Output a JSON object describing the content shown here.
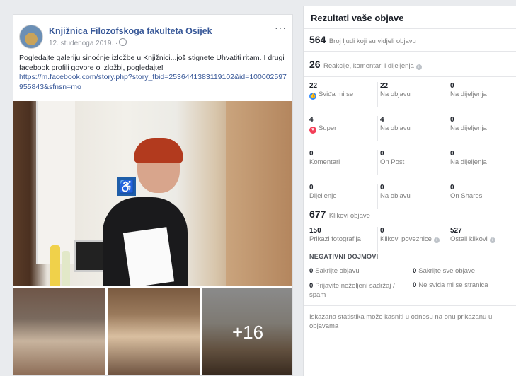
{
  "post": {
    "page_name": "Knjižnica Filozofskoga fakulteta Osijek",
    "date": "12. studenoga 2019. ·",
    "menu": "···",
    "text": "Pogledajte galeriju sinoćnje izložbe u Knjižnici...još stignete Uhvatiti ritam. I drugi facebook profili govore o izložbi, pogledajte!",
    "link": "https://m.facebook.com/story.php?story_fbid=2536441383119102&id=100002597955843&sfnsn=mo",
    "more_photos": "+16",
    "accessibility_sign": "♿"
  },
  "panel": {
    "title": "Rezultati vaše objave",
    "reach": {
      "value": "564",
      "label": "Broj ljudi koji su vidjeli objavu"
    },
    "engagement": {
      "value": "26",
      "label": "Reakcije, komentari i dijeljenja"
    },
    "grid": [
      [
        {
          "n": "22",
          "l": "Sviđa mi se",
          "icon": "like"
        },
        {
          "n": "22",
          "l": "Na objavu"
        },
        {
          "n": "0",
          "l": "Na dijeljenja"
        }
      ],
      [
        {
          "n": "4",
          "l": "Super",
          "icon": "love"
        },
        {
          "n": "4",
          "l": "Na objavu"
        },
        {
          "n": "0",
          "l": "Na dijeljenja"
        }
      ],
      [
        {
          "n": "0",
          "l": "Komentari"
        },
        {
          "n": "0",
          "l": "On Post"
        },
        {
          "n": "0",
          "l": "Na dijeljenja"
        }
      ],
      [
        {
          "n": "0",
          "l": "Dijeljenje"
        },
        {
          "n": "0",
          "l": "Na objavu"
        },
        {
          "n": "0",
          "l": "On Shares"
        }
      ]
    ],
    "clicks": {
      "value": "677",
      "label": "Klikovi objave"
    },
    "click_stats": [
      {
        "n": "150",
        "l": "Prikazi fotografija"
      },
      {
        "n": "0",
        "l": "Klikovi poveznice"
      },
      {
        "n": "527",
        "l": "Ostali klikovi"
      }
    ],
    "negative_title": "NEGATIVNI DOJMOVI",
    "negative": [
      {
        "n": "0",
        "l": "Sakrijte objavu"
      },
      {
        "n": "0",
        "l": "Sakrijte sve objave"
      },
      {
        "n": "0",
        "l": "Prijavite neželjeni sadržaj / spam"
      },
      {
        "n": "0",
        "l": "Ne sviđa mi se stranica"
      }
    ],
    "footnote": "Iskazana statistika može kasniti u odnosu na onu prikazanu u objavama",
    "info_glyph": "i",
    "like_glyph": "👍",
    "love_glyph": "♥"
  },
  "colors": {
    "link": "#385898",
    "like": "#2d88ff",
    "love": "#f33e58"
  }
}
